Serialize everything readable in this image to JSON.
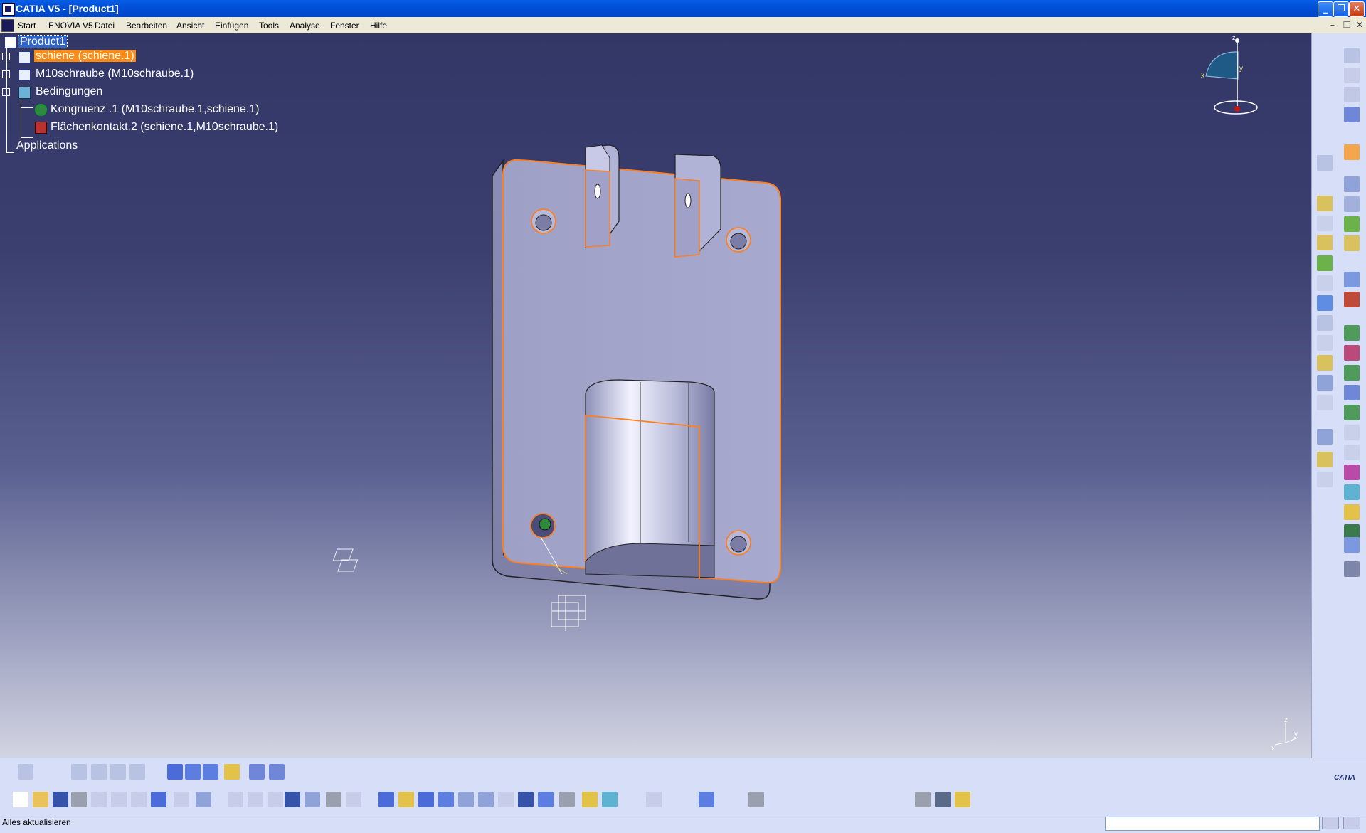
{
  "window": {
    "title": "CATIA V5 - [Product1]"
  },
  "menu": {
    "items": [
      "Start",
      "ENOVIA V5",
      "Datei",
      "Bearbeiten",
      "Ansicht",
      "Einfügen",
      "Tools",
      "Analyse",
      "Fenster",
      "Hilfe"
    ]
  },
  "tree": {
    "root": "Product1",
    "children": [
      "schiene (schiene.1)",
      "M10schraube (M10schraube.1)",
      "Bedingungen",
      "Kongruenz .1 (M10schraube.1,schiene.1)",
      "Flächenkontakt.2 (schiene.1,M10schraube.1)",
      "Applications"
    ]
  },
  "compass": {
    "x": "x",
    "y": "y",
    "z": "z"
  },
  "axis_small": {
    "x": "x",
    "y": "y",
    "z": "z"
  },
  "brand": "CATIA",
  "status": {
    "text": "Alles aktualisieren",
    "command_value": ""
  },
  "icons": {
    "right_toolbar": [
      "measure-icon",
      "annotation-icon",
      "sketch-icon",
      "cube-view-icon",
      "select-arrow-icon",
      "component-icon",
      "catalog-icon",
      "product-icon",
      "part-icon",
      "existing-component-icon",
      "replace-icon",
      "graph-tree-icon",
      "reorder-icon",
      "numbering-icon",
      "multi-instantiate-icon",
      "fast-instantiate-icon",
      "move-icon",
      "snap-icon",
      "explode-icon",
      "coincidence-icon",
      "contact-icon",
      "offset-icon",
      "angle-icon",
      "fix-icon",
      "fix-together-icon",
      "quick-constraint-icon",
      "flexible-icon",
      "change-constraint-icon",
      "reuse-pattern-icon",
      "update-icon",
      "bill-of-material-icon",
      "scenes-icon",
      "clash-icon",
      "sectioning-icon",
      "distance-icon",
      "split-icon",
      "hole-icon",
      "pocket-icon",
      "symmetry-icon",
      "translate-icon"
    ],
    "bottom_toolbar": [
      "new-icon",
      "open-icon",
      "save-icon",
      "print-icon",
      "cut-icon",
      "copy-icon",
      "paste-icon",
      "undo-icon",
      "redo-icon",
      "whats-this-icon",
      "formula-icon",
      "knowledge-icon",
      "light-icon",
      "table-icon",
      "graph-icon",
      "measure-inertia-icon",
      "catalog-browser-icon",
      "fly-icon",
      "fit-all-icon",
      "pan-icon",
      "rotate-icon",
      "zoom-in-icon",
      "zoom-out-icon",
      "normal-view-icon",
      "multi-view-icon",
      "iso-view-icon",
      "view-mode-icon",
      "hide-show-icon",
      "swap-visible-icon",
      "grid-icon",
      "surface-icon",
      "print-device-icon",
      "sections-icon",
      "shading-icon",
      "mouse-icon"
    ]
  }
}
